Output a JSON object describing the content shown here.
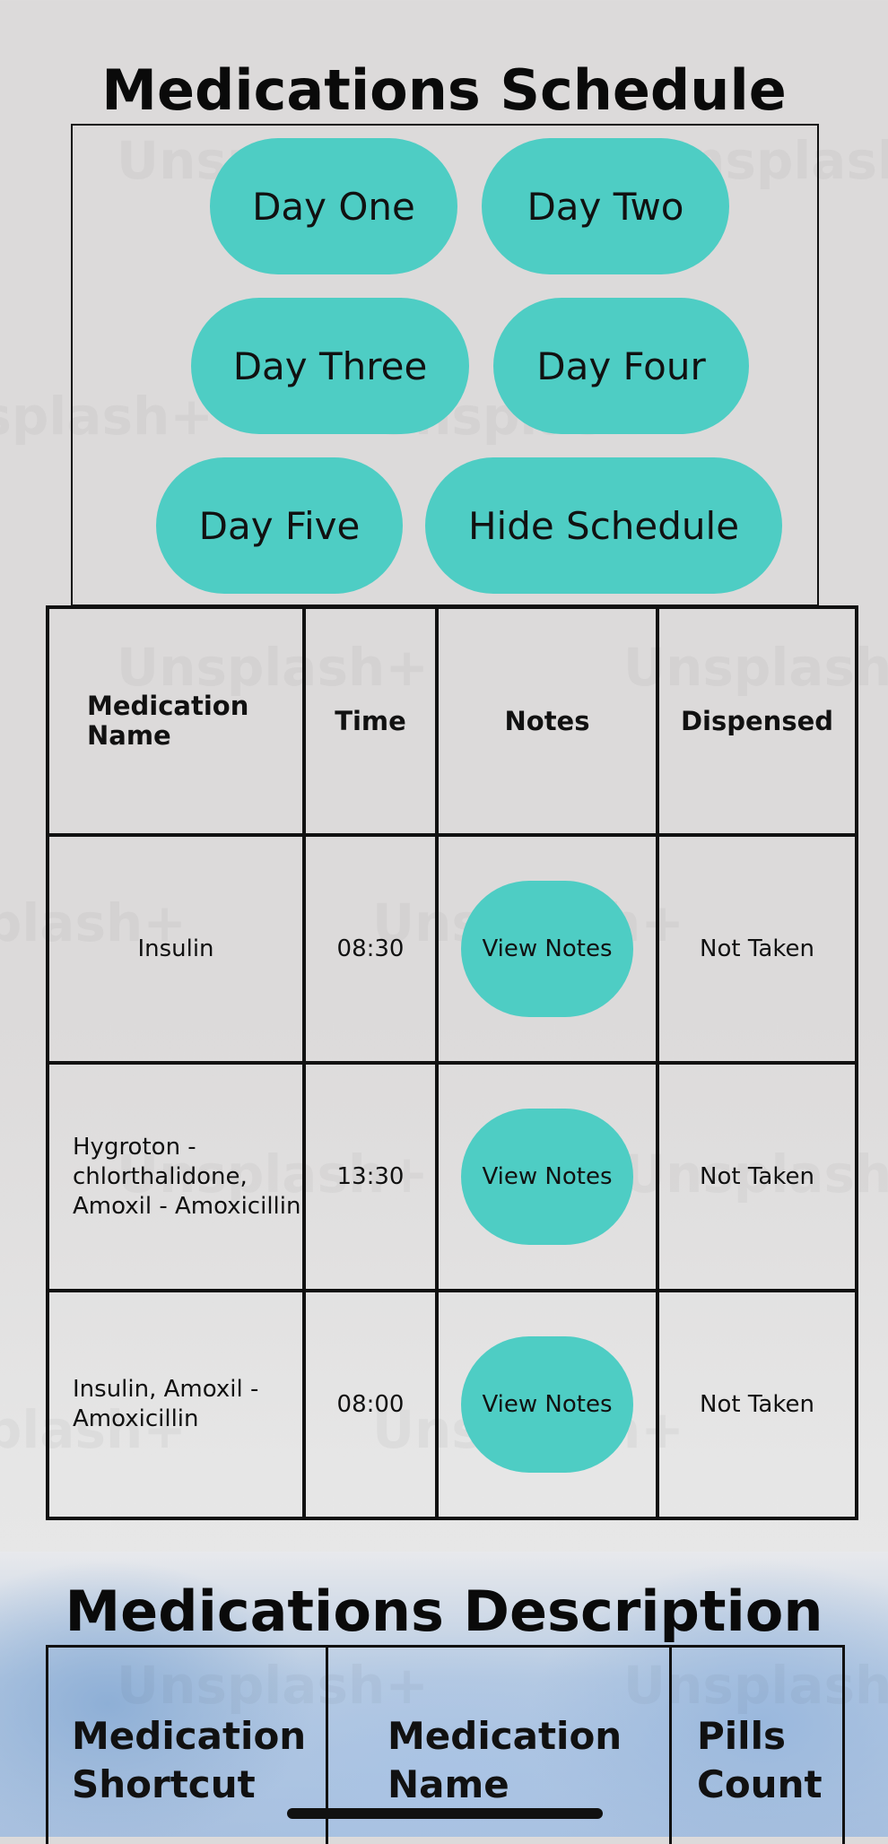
{
  "schedule": {
    "title": "Medications Schedule",
    "buttons": {
      "day_one": "Day One",
      "day_two": "Day Two",
      "day_three": "Day Three",
      "day_four": "Day Four",
      "day_five": "Day Five",
      "hide": "Hide Schedule"
    }
  },
  "table": {
    "headers": [
      "Medication Name",
      "Time",
      "Notes",
      "Dispensed"
    ],
    "rows": [
      {
        "name": "Insulin",
        "time": "08:30",
        "notes": "View Notes",
        "dispensed": "Not Taken"
      },
      {
        "name": "Hygroton - chlorthalidone, Amoxil  - Amoxicillin",
        "time": "13:30",
        "notes": "View Notes",
        "dispensed": "Not Taken"
      },
      {
        "name": "Insulin, Amoxil - Amoxicillin",
        "time": "08:00",
        "notes": "View Notes",
        "dispensed": "Not Taken"
      }
    ]
  },
  "description": {
    "title": "Medications Description",
    "headers": [
      "Medication Shortcut",
      "Medication Name",
      "Pills Count"
    ]
  },
  "watermark": "Unsplash+",
  "colors": {
    "accent": "#4ecdc4",
    "text": "#111111",
    "background": "#dcdada"
  }
}
